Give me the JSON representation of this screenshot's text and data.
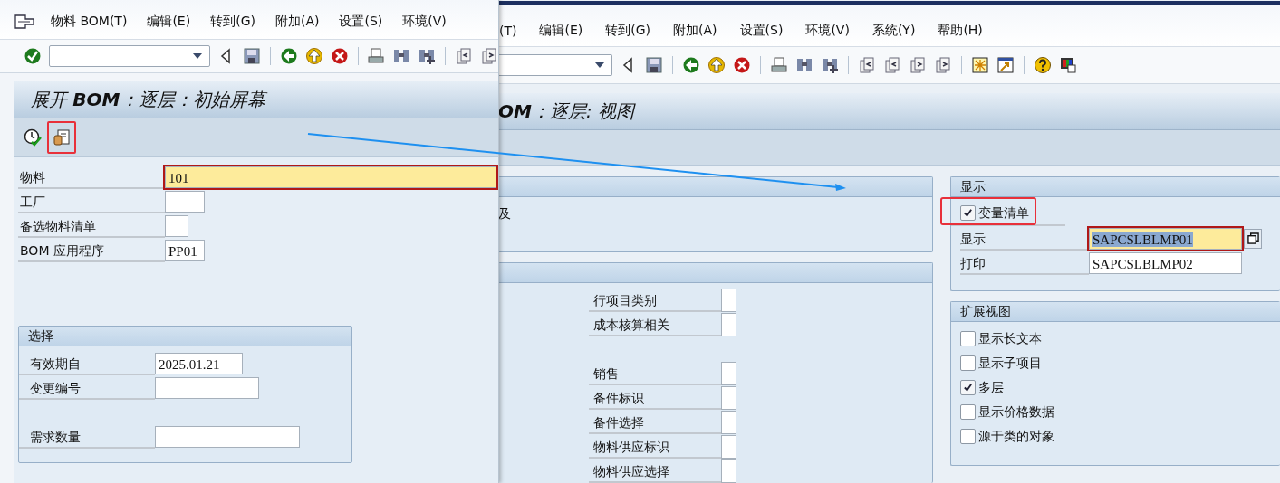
{
  "back_window": {
    "menu": [
      "(T)",
      "编辑(E)",
      "转到(G)",
      "附加(A)",
      "设置(S)",
      "环境(V)",
      "系统(Y)",
      "帮助(H)"
    ],
    "title": "**OM**：逐层: 视图",
    "group_text": "及",
    "indicator_groups": [
      [
        {
          "label": "行项目类别"
        },
        {
          "label": "成本核算相关"
        }
      ],
      [
        {
          "label": "销售"
        },
        {
          "label": "备件标识"
        },
        {
          "label": "备件选择"
        },
        {
          "label": "物料供应标识"
        },
        {
          "label": "物料供应选择"
        }
      ]
    ],
    "display": {
      "title": "显示",
      "variant_list": {
        "label": "变量清单",
        "checked": true
      },
      "fields": [
        {
          "label": "显示",
          "value": "SAPCSLBLMP01",
          "focused": true
        },
        {
          "label": "打印",
          "value": "SAPCSLBLMP02",
          "focused": false
        }
      ]
    },
    "extended_view": {
      "title": "扩展视图",
      "options": [
        {
          "label": "显示长文本",
          "checked": false
        },
        {
          "label": "显示子项目",
          "checked": false
        },
        {
          "label": "多层",
          "checked": true
        },
        {
          "label": "显示价格数据",
          "checked": false
        },
        {
          "label": "源于类的对象",
          "checked": false
        }
      ]
    }
  },
  "front_window": {
    "menu": [
      "物料 BOM(T)",
      "编辑(E)",
      "转到(G)",
      "附加(A)",
      "设置(S)",
      "环境(V)"
    ],
    "title": "展开 **BOM**：逐层：初始屏幕",
    "fields": [
      {
        "label": "物料",
        "value": "101",
        "focused": true
      },
      {
        "label": "工厂",
        "focused": false
      },
      {
        "label": "备选物料清单",
        "focused": false
      },
      {
        "label": "BOM 应用程序",
        "value": "PP01",
        "focused": false
      }
    ],
    "selection": {
      "title": "选择",
      "field_groups": [
        [
          {
            "label": "有效期自",
            "value": "2025.01.21"
          },
          {
            "label": "变更编号"
          }
        ],
        [
          {
            "label": "需求数量"
          }
        ]
      ]
    }
  }
}
